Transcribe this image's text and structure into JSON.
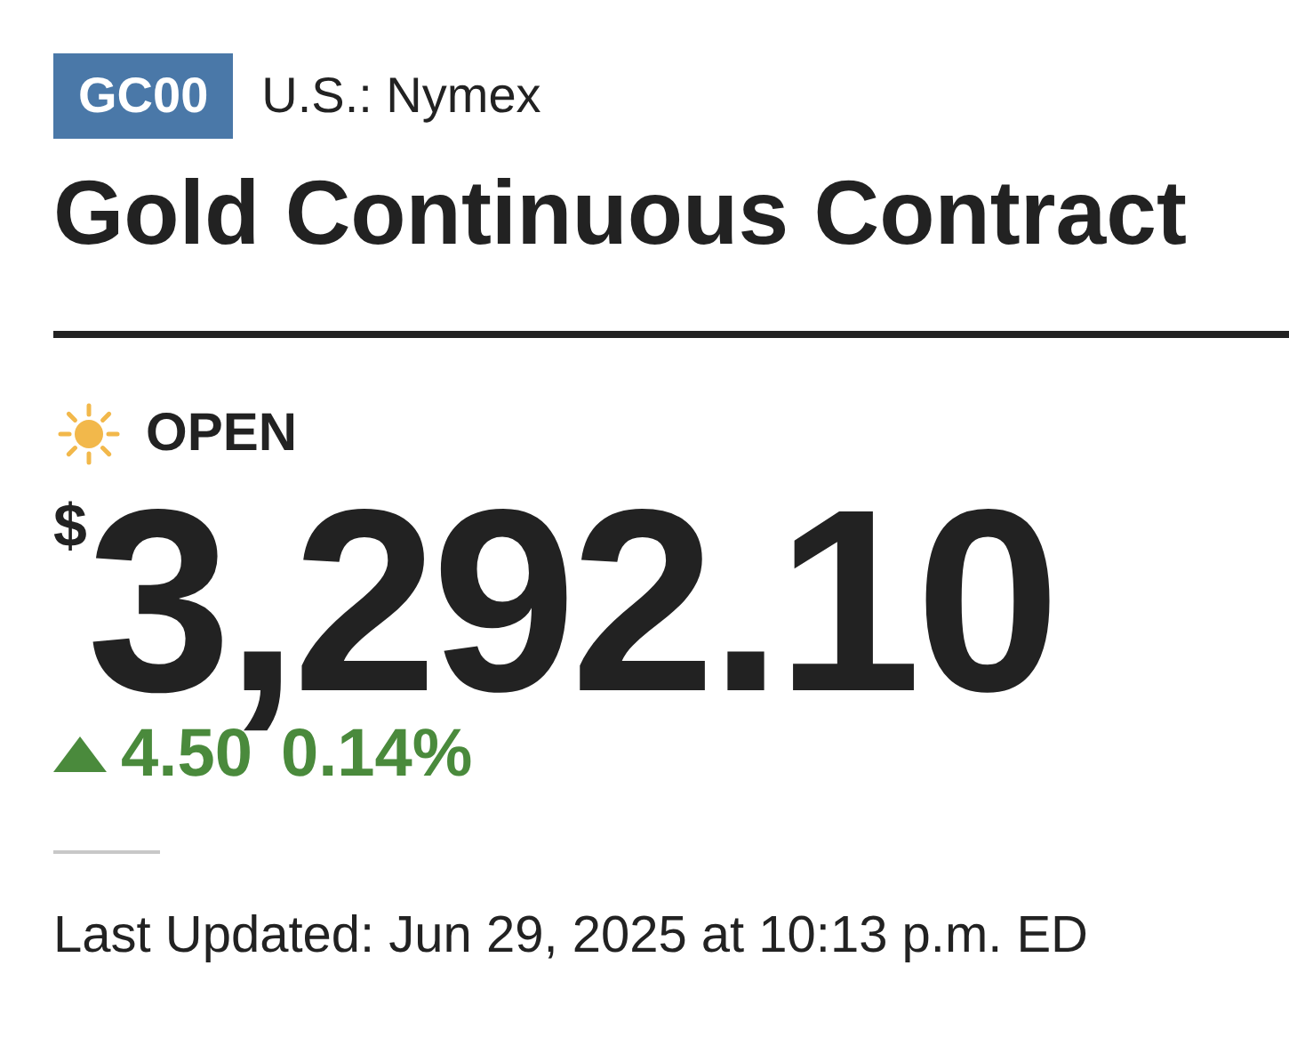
{
  "header": {
    "ticker": "GC00",
    "exchange": "U.S.: Nymex",
    "title": "Gold Continuous Contract"
  },
  "status": {
    "kind": "open",
    "label": "OPEN"
  },
  "price": {
    "currency": "$",
    "value": "3,292.10"
  },
  "change": {
    "rising": true,
    "amount": "4.50",
    "percent": "0.14%"
  },
  "last_updated": "Last Updated: Jun 29, 2025 at 10:13 p.m. ED"
}
